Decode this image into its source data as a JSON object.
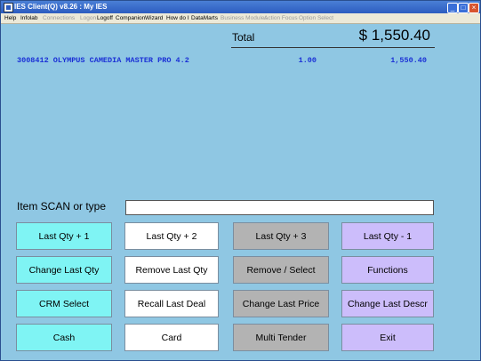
{
  "window": {
    "title": "IES Client(Q) v8.26 : My IES",
    "controls": {
      "minimize": "_",
      "maximize": "□",
      "close": "×"
    }
  },
  "menu": [
    {
      "label": "Help",
      "enabled": true
    },
    {
      "label": "Infolab",
      "enabled": true
    },
    {
      "label": "Connections",
      "enabled": false
    },
    {
      "label": "Logon",
      "enabled": false
    },
    {
      "label": "Logoff",
      "enabled": true
    },
    {
      "label": "Companion",
      "enabled": true
    },
    {
      "label": "Wizard",
      "enabled": true
    },
    {
      "label": "How do I",
      "enabled": true
    },
    {
      "label": "DataMarts",
      "enabled": true
    },
    {
      "label": "Business Modules",
      "enabled": false
    },
    {
      "label": "Action Focus",
      "enabled": false
    },
    {
      "label": "Option Select",
      "enabled": false
    }
  ],
  "total": {
    "label": "Total",
    "value": "$ 1,550.40"
  },
  "line_items": [
    {
      "description": "3008412 OLYMPUS CAMEDIA MASTER PRO 4.2",
      "qty": "1.00",
      "amount": "1,550.40"
    }
  ],
  "scan": {
    "label": "Item SCAN or type",
    "value": ""
  },
  "buttons": [
    [
      "Last Qty + 1",
      "Last Qty + 2",
      "Last Qty + 3",
      "Last Qty - 1"
    ],
    [
      "Change Last Qty",
      "Remove Last Qty",
      "Remove / Select",
      "Functions"
    ],
    [
      "CRM Select",
      "Recall Last Deal",
      "Change Last Price",
      "Change Last Descr"
    ],
    [
      "Cash",
      "Card",
      "Multi Tender",
      "Exit"
    ]
  ],
  "colors": {
    "background": "#8fc7e3",
    "column1": "#7ff4f4",
    "column2": "#ffffff",
    "column3": "#b3b3b3",
    "column4": "#ccbdfb",
    "line_item_text": "#1a2fd6"
  }
}
